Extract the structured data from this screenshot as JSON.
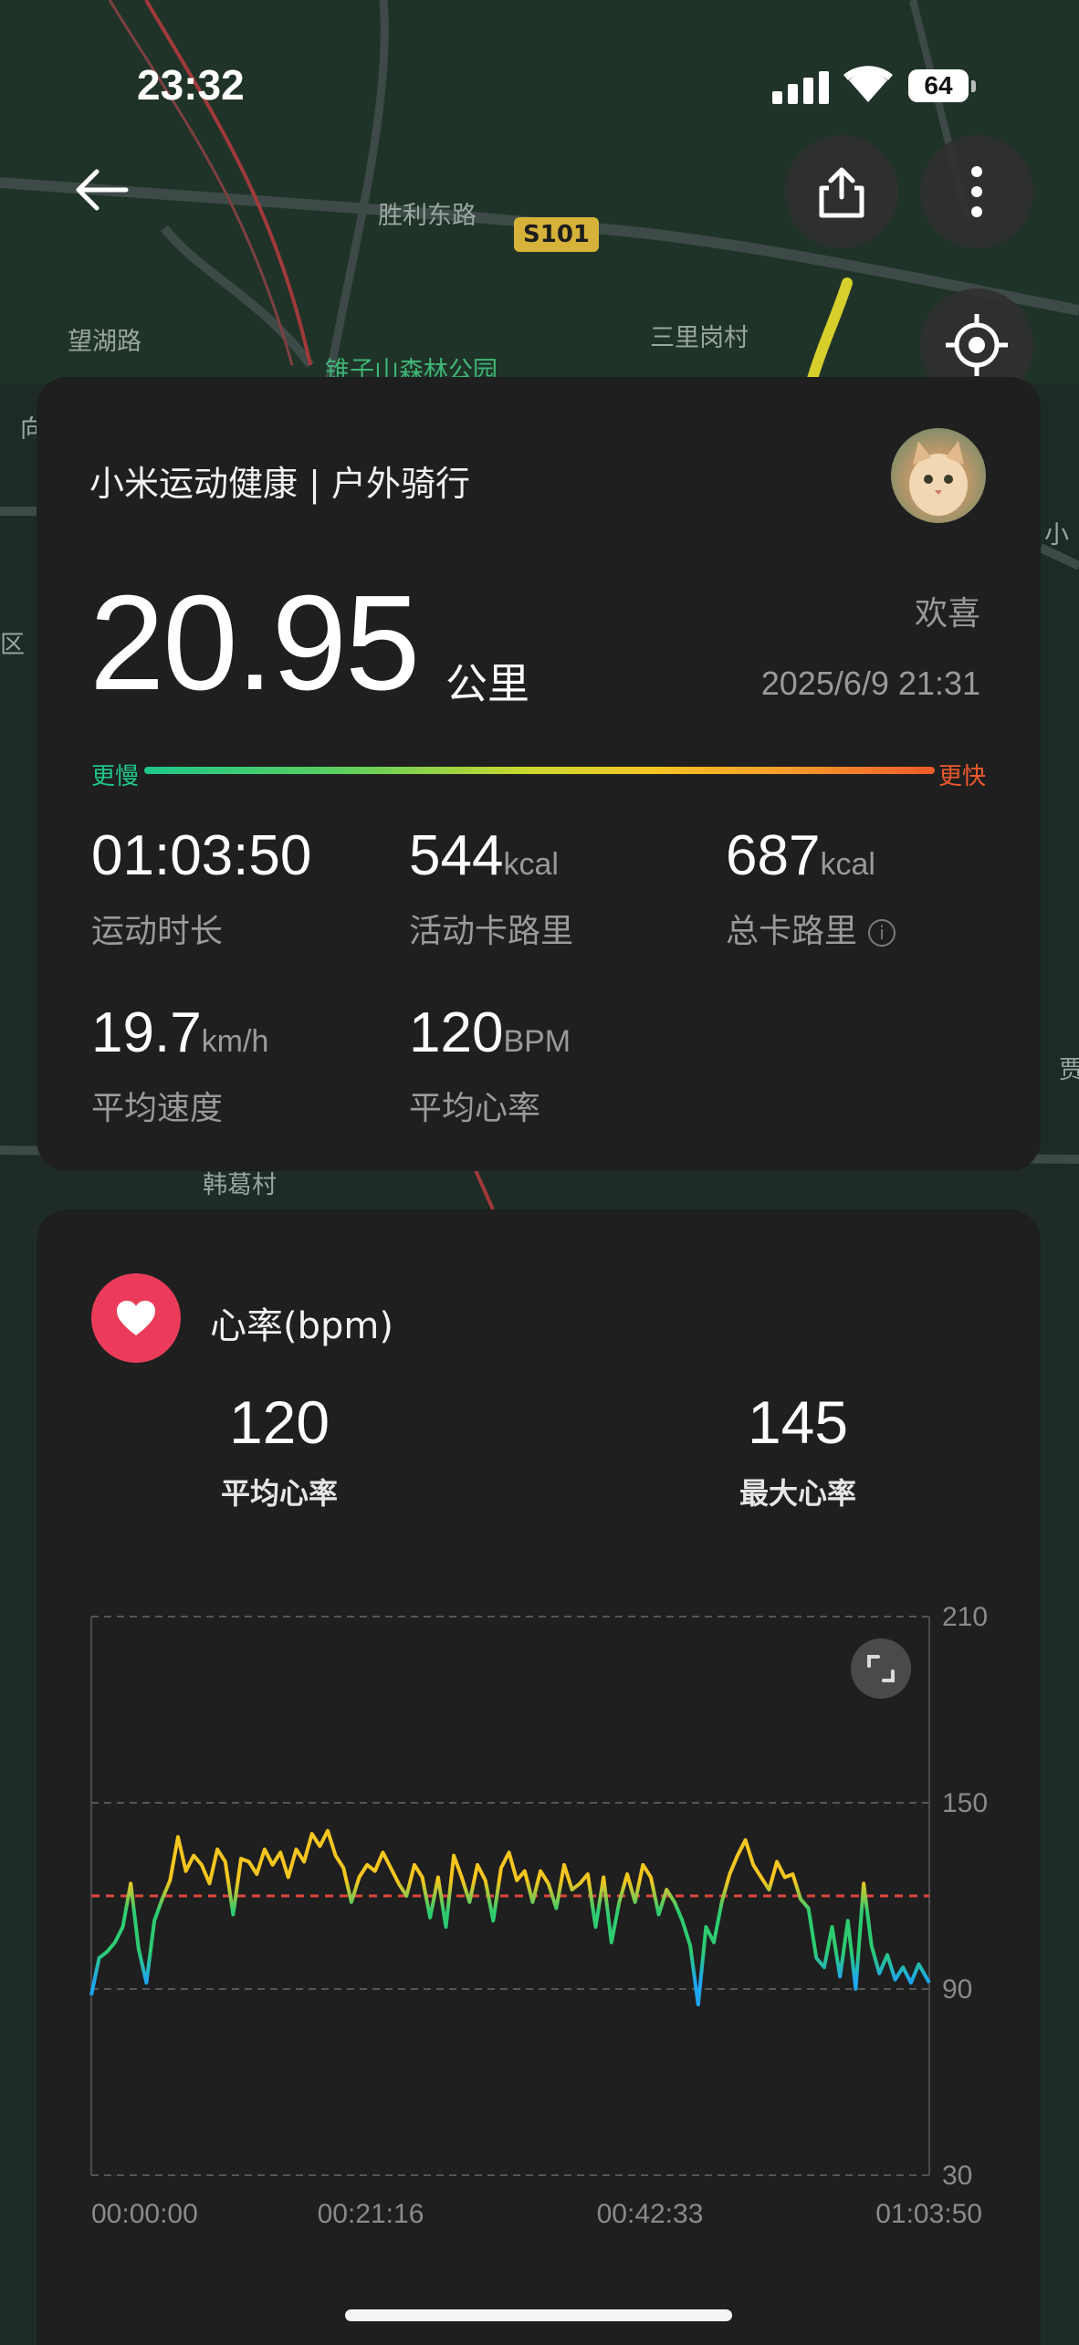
{
  "status_bar": {
    "time": "23:32",
    "battery": "64"
  },
  "map": {
    "labels": {
      "road_shengli": "胜利东路",
      "route_badge": "S101",
      "road_wanghu": "望湖路",
      "park": "锥子山森林公园",
      "village_sanli": "三里岗村",
      "village_han": "韩葛村",
      "edge_xiang": "向",
      "edge_qu": "区",
      "edge_xiao": "小",
      "edge_jia": "贾"
    }
  },
  "toolbar": {
    "back_icon": "arrow-left-icon",
    "share_icon": "share-icon",
    "more_icon": "more-vertical-icon",
    "locate_icon": "locate-icon"
  },
  "summary": {
    "title": "小米运动健康 | 户外骑行",
    "distance": "20.95",
    "distance_unit": "公里",
    "user_name": "欢喜",
    "datetime": "2025/6/9 21:31",
    "speed_slow": "更慢",
    "speed_fast": "更快",
    "stats": [
      {
        "value": "01:03:50",
        "unit": "",
        "label": "运动时长"
      },
      {
        "value": "544",
        "unit": "kcal",
        "label": "活动卡路里"
      },
      {
        "value": "687",
        "unit": "kcal",
        "label": "总卡路里"
      },
      {
        "value": "19.7",
        "unit": "km/h",
        "label": "平均速度"
      },
      {
        "value": "120",
        "unit": "BPM",
        "label": "平均心率"
      }
    ]
  },
  "heart_rate": {
    "title": "心率(bpm)",
    "avg_value": "120",
    "avg_label": "平均心率",
    "max_value": "145",
    "max_label": "最大心率"
  },
  "chart_data": {
    "type": "line",
    "ylim": [
      30,
      210
    ],
    "y_ticks": [
      "210",
      "150",
      "90",
      "30"
    ],
    "x_ticks": [
      "00:00:00",
      "00:21:16",
      "00:42:33",
      "01:03:50"
    ],
    "reference_line": 120,
    "colors": {
      "high": "#f4c61f",
      "mid": "#2ecc71",
      "low": "#1ea7f0",
      "reference": "#e0453c"
    },
    "x_minutes": [
      0,
      0.6,
      1.2,
      1.8,
      2.4,
      3.0,
      3.6,
      4.2,
      4.8,
      5.4,
      6.0,
      6.6,
      7.2,
      7.8,
      8.4,
      9.0,
      9.6,
      10.2,
      10.8,
      11.4,
      12.0,
      12.6,
      13.2,
      13.8,
      14.4,
      15.0,
      15.6,
      16.2,
      16.8,
      17.4,
      18.0,
      18.6,
      19.2,
      19.8,
      20.4,
      21.0,
      21.6,
      22.2,
      22.8,
      23.4,
      24.0,
      24.6,
      25.2,
      25.8,
      26.4,
      27.0,
      27.6,
      28.2,
      28.8,
      29.4,
      30.0,
      30.6,
      31.2,
      31.8,
      32.4,
      33.0,
      33.6,
      34.2,
      34.8,
      35.4,
      36.0,
      36.6,
      37.2,
      37.8,
      38.4,
      39.0,
      39.6,
      40.2,
      40.8,
      41.4,
      42.0,
      42.6,
      43.2,
      43.8,
      44.4,
      45.0,
      45.6,
      46.2,
      46.8,
      47.4,
      48.0,
      48.6,
      49.2,
      49.8,
      50.4,
      51.0,
      51.6,
      52.2,
      52.8,
      53.4,
      54.0,
      54.6,
      55.2,
      55.8,
      56.4,
      57.0,
      57.6,
      58.2,
      58.8,
      59.4,
      60.0,
      60.6,
      61.2,
      61.8,
      62.4,
      63.0,
      63.8
    ],
    "values": [
      88,
      100,
      102,
      105,
      110,
      124,
      103,
      92,
      112,
      119,
      125,
      139,
      128,
      133,
      130,
      124,
      135,
      131,
      114,
      132,
      131,
      127,
      135,
      130,
      134,
      126,
      135,
      131,
      140,
      136,
      141,
      133,
      129,
      118,
      126,
      130,
      128,
      134,
      129,
      124,
      120,
      130,
      126,
      113,
      126,
      110,
      133,
      126,
      118,
      130,
      125,
      112,
      129,
      134,
      125,
      128,
      118,
      128,
      124,
      116,
      130,
      122,
      124,
      127,
      110,
      126,
      105,
      118,
      127,
      118,
      130,
      126,
      114,
      122,
      118,
      112,
      104,
      85,
      110,
      105,
      118,
      127,
      133,
      138,
      130,
      126,
      122,
      131,
      126,
      127,
      119,
      116,
      100,
      97,
      110,
      94,
      112,
      90,
      124,
      104,
      95,
      101,
      93,
      97,
      92,
      98,
      92
    ],
    "series": [
      {
        "values": "values"
      }
    ]
  }
}
